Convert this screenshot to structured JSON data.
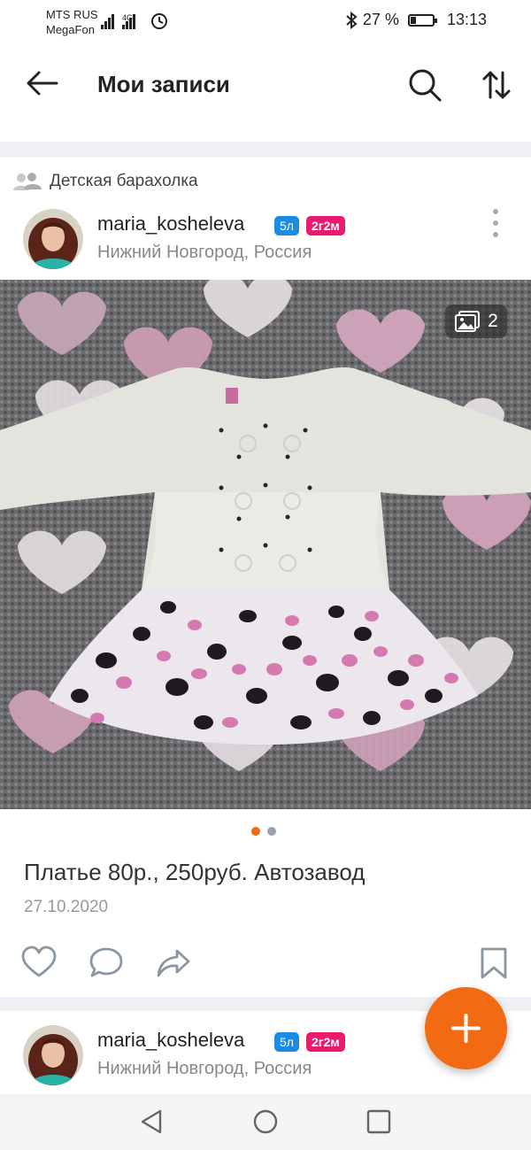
{
  "status_bar": {
    "carrier_1": "MTS RUS",
    "carrier_2": "MegaFon",
    "network": "4G",
    "battery_percent": "27 %",
    "battery_level": 0.27,
    "time": "13:13"
  },
  "header": {
    "title": "Мои записи",
    "icons": [
      "arrow-left-icon",
      "search-icon",
      "sort-icon"
    ]
  },
  "post": {
    "group_name": "Детская барахолка",
    "author": {
      "name": "maria_kosheleva",
      "badge_1": "5л",
      "badge_2": "2г2м",
      "location": "Нижний Новгород, Россия"
    },
    "photo_count": "2",
    "pager": {
      "total": 2,
      "active": 0
    },
    "title": "Платье 80р., 250руб. Автозавод",
    "date": "27.10.2020",
    "actions": [
      "heart-icon",
      "comment-icon",
      "share-icon",
      "bookmark-icon"
    ]
  },
  "next_post": {
    "author": {
      "name": "maria_kosheleva",
      "badge_1": "5л",
      "badge_2": "2г2м",
      "location": "Нижний Новгород, Россия"
    }
  },
  "fab": {
    "icon": "plus-icon"
  },
  "nav": {
    "icons": [
      "back-triangle-icon",
      "home-circle-icon",
      "recents-square-icon"
    ]
  },
  "colors": {
    "accent_orange": "#f26b13",
    "badge_blue": "#1a8ce6",
    "badge_pink": "#ea1a6e",
    "pager_inactive": "#9aa3ad"
  }
}
